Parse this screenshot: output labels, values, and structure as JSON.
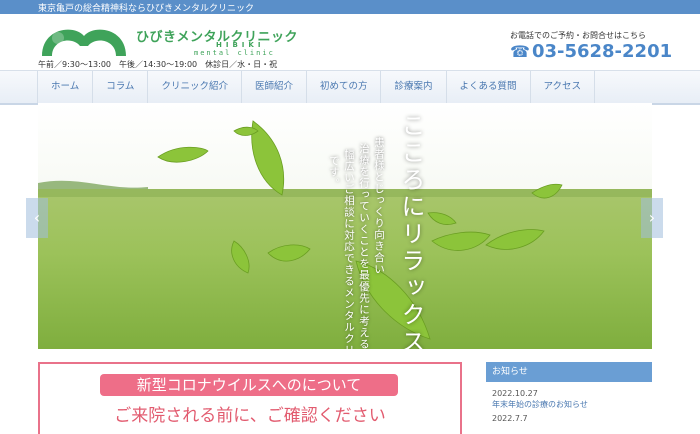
{
  "top_bar": {
    "text": "東京亀戸の総合精神科ならひびきメンタルクリニック"
  },
  "logo": {
    "mark_text": "ひびき",
    "name_ja": "ひびきメンタルクリニック",
    "name_en1": "HIBIKI",
    "name_en2": "mental clinic"
  },
  "hours": "午前／9:30〜13:00　午後／14:30〜19:00　休診日／水・日・祝",
  "contact": {
    "note": "お電話でのご予約・お問合せはこちら",
    "phone": "03-5628-2201"
  },
  "nav": {
    "items": [
      {
        "label": "ホーム"
      },
      {
        "label": "コラム"
      },
      {
        "label": "クリニック紹介"
      },
      {
        "label": "医師紹介"
      },
      {
        "label": "初めての方"
      },
      {
        "label": "診療案内"
      },
      {
        "label": "よくある質問"
      },
      {
        "label": "アクセス"
      }
    ]
  },
  "hero": {
    "title": "こころにリラックスを",
    "lines": [
      "患者様とじっくり向き合い",
      "治療を行っていくことを最優先に考える。",
      "幅広いご相談に対応できるメンタルクリニック",
      "です。"
    ],
    "prev_icon": "‹",
    "next_icon": "›"
  },
  "notice": {
    "badge": "新型コロナウイルスへのについて",
    "subtitle": "ご来院される前に、ご確認ください"
  },
  "news": {
    "heading": "お知らせ",
    "items": [
      {
        "date": "2022.10.27",
        "title": "年末年始の診療のお知らせ"
      },
      {
        "date": "2022.7.7",
        "title": ""
      }
    ]
  },
  "colors": {
    "brand_green": "#3fa35a",
    "accent_blue": "#4a86c8",
    "notice_pink": "#ee6e88"
  }
}
